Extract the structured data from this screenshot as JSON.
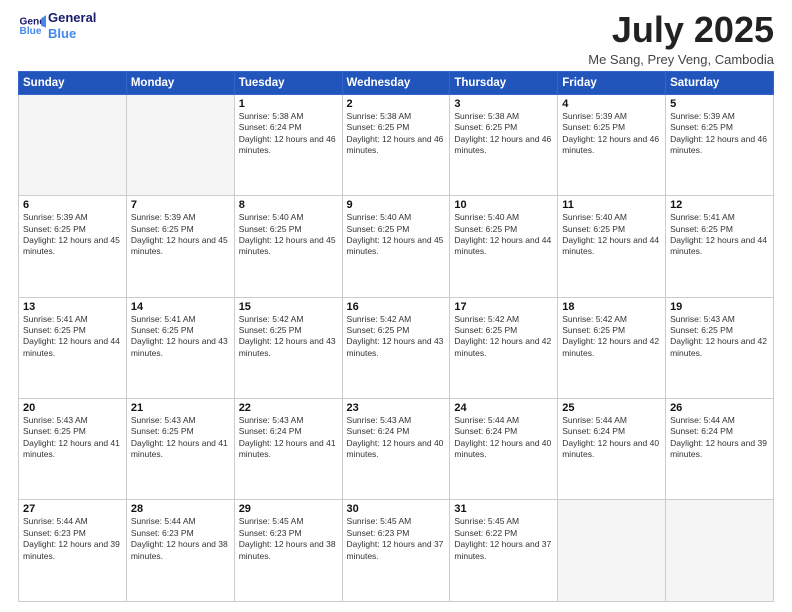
{
  "header": {
    "logo_line1": "General",
    "logo_line2": "Blue",
    "title": "July 2025",
    "subtitle": "Me Sang, Prey Veng, Cambodia"
  },
  "weekdays": [
    "Sunday",
    "Monday",
    "Tuesday",
    "Wednesday",
    "Thursday",
    "Friday",
    "Saturday"
  ],
  "weeks": [
    [
      {
        "day": "",
        "detail": ""
      },
      {
        "day": "",
        "detail": ""
      },
      {
        "day": "1",
        "detail": "Sunrise: 5:38 AM\nSunset: 6:24 PM\nDaylight: 12 hours and 46 minutes."
      },
      {
        "day": "2",
        "detail": "Sunrise: 5:38 AM\nSunset: 6:25 PM\nDaylight: 12 hours and 46 minutes."
      },
      {
        "day": "3",
        "detail": "Sunrise: 5:38 AM\nSunset: 6:25 PM\nDaylight: 12 hours and 46 minutes."
      },
      {
        "day": "4",
        "detail": "Sunrise: 5:39 AM\nSunset: 6:25 PM\nDaylight: 12 hours and 46 minutes."
      },
      {
        "day": "5",
        "detail": "Sunrise: 5:39 AM\nSunset: 6:25 PM\nDaylight: 12 hours and 46 minutes."
      }
    ],
    [
      {
        "day": "6",
        "detail": "Sunrise: 5:39 AM\nSunset: 6:25 PM\nDaylight: 12 hours and 45 minutes."
      },
      {
        "day": "7",
        "detail": "Sunrise: 5:39 AM\nSunset: 6:25 PM\nDaylight: 12 hours and 45 minutes."
      },
      {
        "day": "8",
        "detail": "Sunrise: 5:40 AM\nSunset: 6:25 PM\nDaylight: 12 hours and 45 minutes."
      },
      {
        "day": "9",
        "detail": "Sunrise: 5:40 AM\nSunset: 6:25 PM\nDaylight: 12 hours and 45 minutes."
      },
      {
        "day": "10",
        "detail": "Sunrise: 5:40 AM\nSunset: 6:25 PM\nDaylight: 12 hours and 44 minutes."
      },
      {
        "day": "11",
        "detail": "Sunrise: 5:40 AM\nSunset: 6:25 PM\nDaylight: 12 hours and 44 minutes."
      },
      {
        "day": "12",
        "detail": "Sunrise: 5:41 AM\nSunset: 6:25 PM\nDaylight: 12 hours and 44 minutes."
      }
    ],
    [
      {
        "day": "13",
        "detail": "Sunrise: 5:41 AM\nSunset: 6:25 PM\nDaylight: 12 hours and 44 minutes."
      },
      {
        "day": "14",
        "detail": "Sunrise: 5:41 AM\nSunset: 6:25 PM\nDaylight: 12 hours and 43 minutes."
      },
      {
        "day": "15",
        "detail": "Sunrise: 5:42 AM\nSunset: 6:25 PM\nDaylight: 12 hours and 43 minutes."
      },
      {
        "day": "16",
        "detail": "Sunrise: 5:42 AM\nSunset: 6:25 PM\nDaylight: 12 hours and 43 minutes."
      },
      {
        "day": "17",
        "detail": "Sunrise: 5:42 AM\nSunset: 6:25 PM\nDaylight: 12 hours and 42 minutes."
      },
      {
        "day": "18",
        "detail": "Sunrise: 5:42 AM\nSunset: 6:25 PM\nDaylight: 12 hours and 42 minutes."
      },
      {
        "day": "19",
        "detail": "Sunrise: 5:43 AM\nSunset: 6:25 PM\nDaylight: 12 hours and 42 minutes."
      }
    ],
    [
      {
        "day": "20",
        "detail": "Sunrise: 5:43 AM\nSunset: 6:25 PM\nDaylight: 12 hours and 41 minutes."
      },
      {
        "day": "21",
        "detail": "Sunrise: 5:43 AM\nSunset: 6:25 PM\nDaylight: 12 hours and 41 minutes."
      },
      {
        "day": "22",
        "detail": "Sunrise: 5:43 AM\nSunset: 6:24 PM\nDaylight: 12 hours and 41 minutes."
      },
      {
        "day": "23",
        "detail": "Sunrise: 5:43 AM\nSunset: 6:24 PM\nDaylight: 12 hours and 40 minutes."
      },
      {
        "day": "24",
        "detail": "Sunrise: 5:44 AM\nSunset: 6:24 PM\nDaylight: 12 hours and 40 minutes."
      },
      {
        "day": "25",
        "detail": "Sunrise: 5:44 AM\nSunset: 6:24 PM\nDaylight: 12 hours and 40 minutes."
      },
      {
        "day": "26",
        "detail": "Sunrise: 5:44 AM\nSunset: 6:24 PM\nDaylight: 12 hours and 39 minutes."
      }
    ],
    [
      {
        "day": "27",
        "detail": "Sunrise: 5:44 AM\nSunset: 6:23 PM\nDaylight: 12 hours and 39 minutes."
      },
      {
        "day": "28",
        "detail": "Sunrise: 5:44 AM\nSunset: 6:23 PM\nDaylight: 12 hours and 38 minutes."
      },
      {
        "day": "29",
        "detail": "Sunrise: 5:45 AM\nSunset: 6:23 PM\nDaylight: 12 hours and 38 minutes."
      },
      {
        "day": "30",
        "detail": "Sunrise: 5:45 AM\nSunset: 6:23 PM\nDaylight: 12 hours and 37 minutes."
      },
      {
        "day": "31",
        "detail": "Sunrise: 5:45 AM\nSunset: 6:22 PM\nDaylight: 12 hours and 37 minutes."
      },
      {
        "day": "",
        "detail": ""
      },
      {
        "day": "",
        "detail": ""
      }
    ]
  ]
}
